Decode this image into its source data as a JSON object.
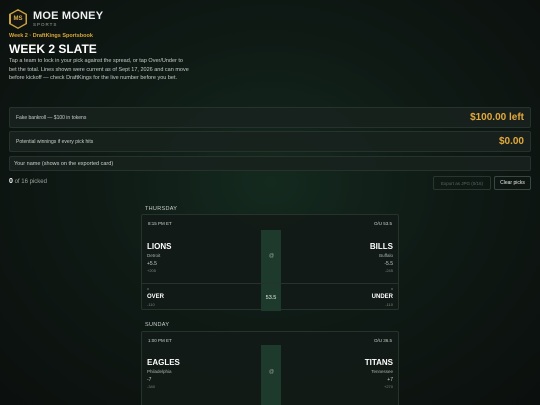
{
  "brand": {
    "logo": "MS",
    "name": "MOE MONEY",
    "sub": "SPORTS"
  },
  "eyebrow": "Week 2 · DraftKings Sportsbook",
  "page_title": "WEEK 2 SLATE",
  "intro": "Tap a team to lock in your pick against the spread, or tap Over/Under to bet the total. Lines shown were current as of Sept 17, 2026 and can move before kickoff — check DraftKings for the live number before you bet.",
  "bankroll": {
    "label": "Fake bankroll — $100 in tokens",
    "value": "$100.00 left"
  },
  "winnings": {
    "label": "Potential winnings if every pick hits",
    "value": "$0.00"
  },
  "name_placeholder": "Your name (shows on the exported card)",
  "picked": {
    "count": "0",
    "text": "of 16 picked"
  },
  "buttons": {
    "export": "Export as JPG (0/16)",
    "clear": "Clear picks"
  },
  "days": [
    {
      "day": "THURSDAY",
      "game": {
        "time": "8:15 PM ET",
        "ou": "O/U 53.5",
        "at": "@",
        "away": {
          "name": "LIONS",
          "city": "Detroit",
          "spread": "+5.5",
          "odds": "+205"
        },
        "home": {
          "name": "BILLS",
          "city": "Buffalo",
          "spread": "-5.5",
          "odds": "-245"
        },
        "over": {
          "label": "OVER",
          "odds": "-110"
        },
        "under": {
          "label": "UNDER",
          "odds": "-110"
        },
        "total": "53.5"
      }
    },
    {
      "day": "SUNDAY",
      "game": {
        "time": "1:00 PM ET",
        "ou": "O/U 36.5",
        "at": "@",
        "away": {
          "name": "EAGLES",
          "city": "Philadelphia",
          "spread": "-7",
          "odds": "-340"
        },
        "home": {
          "name": "TITANS",
          "city": "Tennessee",
          "spread": "+7",
          "odds": "+270"
        }
      }
    }
  ]
}
